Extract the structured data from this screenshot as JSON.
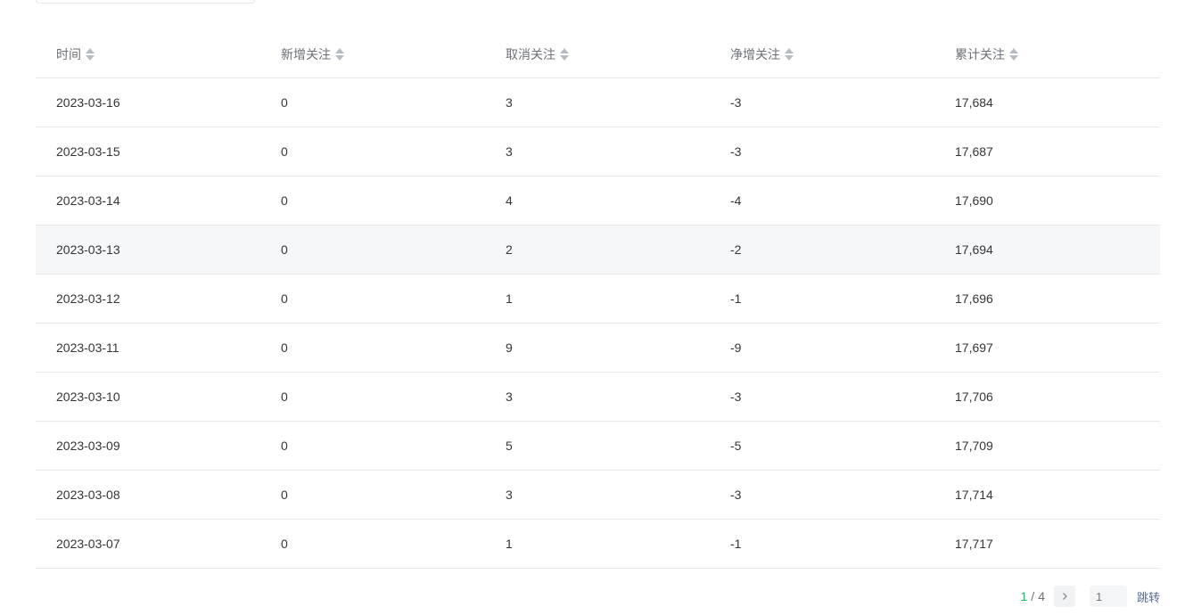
{
  "table": {
    "headers": [
      "时间",
      "新增关注",
      "取消关注",
      "净增关注",
      "累计关注"
    ],
    "rows": [
      [
        "2023-03-16",
        "0",
        "3",
        "-3",
        "17,684"
      ],
      [
        "2023-03-15",
        "0",
        "3",
        "-3",
        "17,687"
      ],
      [
        "2023-03-14",
        "0",
        "4",
        "-4",
        "17,690"
      ],
      [
        "2023-03-13",
        "0",
        "2",
        "-2",
        "17,694"
      ],
      [
        "2023-03-12",
        "0",
        "1",
        "-1",
        "17,696"
      ],
      [
        "2023-03-11",
        "0",
        "9",
        "-9",
        "17,697"
      ],
      [
        "2023-03-10",
        "0",
        "3",
        "-3",
        "17,706"
      ],
      [
        "2023-03-09",
        "0",
        "5",
        "-5",
        "17,709"
      ],
      [
        "2023-03-08",
        "0",
        "3",
        "-3",
        "17,714"
      ],
      [
        "2023-03-07",
        "0",
        "1",
        "-1",
        "17,717"
      ]
    ]
  },
  "pagination": {
    "current": "1",
    "separator": "/",
    "total": "4",
    "jump_placeholder": "1",
    "jump_label": "跳转"
  },
  "icons": {
    "sort": "sort-icon",
    "next": "chevron-right-icon"
  },
  "colors": {
    "accent": "#07c160",
    "link": "#576b95",
    "row_hover": "#f6f7f9"
  }
}
